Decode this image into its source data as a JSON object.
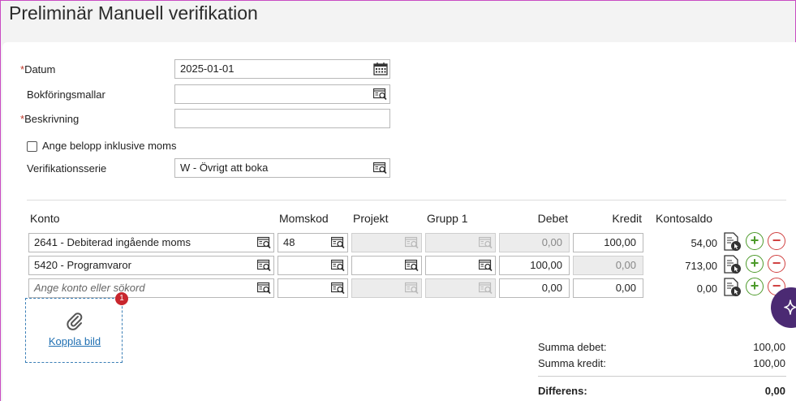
{
  "page": {
    "title": "Preliminär Manuell verifikation"
  },
  "form": {
    "required_mark": "*",
    "date_label": "Datum",
    "date_value": "2025-01-01",
    "templates_label": "Bokföringsmallar",
    "templates_value": "",
    "description_label": "Beskrivning",
    "description_value": "",
    "incl_vat_label": "Ange belopp inklusive moms",
    "incl_vat_checked": false,
    "series_label": "Verifikationsserie",
    "series_value": "W - Övrigt att boka"
  },
  "table": {
    "headers": {
      "account": "Konto",
      "vat_code": "Momskod",
      "project": "Projekt",
      "group": "Grupp 1",
      "debit": "Debet",
      "credit": "Kredit",
      "balance": "Kontosaldo"
    },
    "rows": [
      {
        "account": "2641 - Debiterad ingående moms",
        "vat_code": "48",
        "project": "",
        "group": "",
        "debit": "0,00",
        "credit": "100,00",
        "balance": "54,00"
      },
      {
        "account": "5420 - Programvaror",
        "vat_code": "",
        "project": "",
        "group": "",
        "debit": "100,00",
        "credit": "0,00",
        "balance": "713,00"
      },
      {
        "account": "",
        "account_placeholder": "Ange konto eller sökord",
        "vat_code": "",
        "project": "",
        "group": "",
        "debit": "0,00",
        "credit": "0,00",
        "balance": "0,00"
      }
    ]
  },
  "attachment": {
    "link_label": "Koppla bild",
    "badge_count": "1"
  },
  "summary": {
    "debit_label": "Summa debet:",
    "debit_value": "100,00",
    "credit_label": "Summa kredit:",
    "credit_value": "100,00",
    "diff_label": "Differens:",
    "diff_value": "0,00"
  },
  "icons": {
    "calendar": "calendar-icon",
    "lookup": "lookup-icon",
    "account_info": "account-info-icon",
    "add_row": "plus-circle-icon",
    "remove_row": "minus-circle-icon",
    "paperclip": "paperclip-icon",
    "assistant": "sparkle-icon"
  },
  "colors": {
    "accent_link": "#1f6fb2",
    "add": "#4c9a2a",
    "remove": "#d04040",
    "badge": "#c8262d",
    "fab": "#4b2a73"
  }
}
